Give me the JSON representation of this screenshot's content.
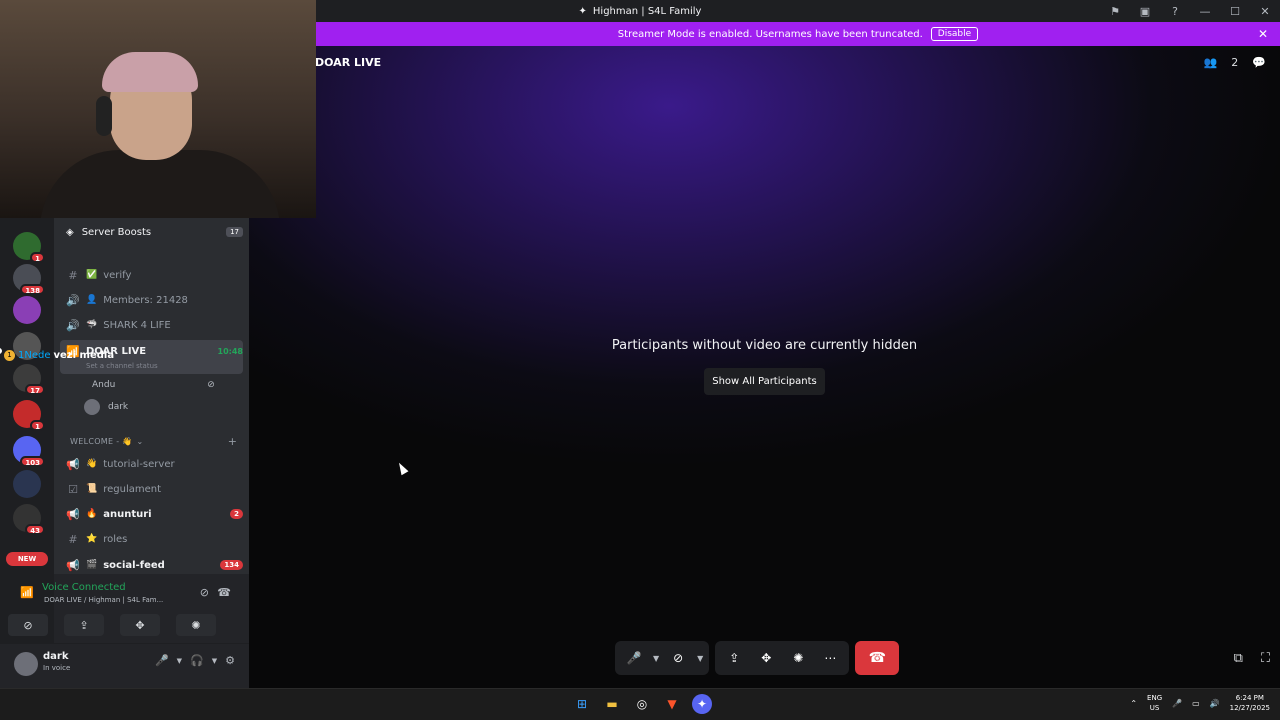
{
  "window": {
    "title": "Highman | S4L Family"
  },
  "banner": {
    "text": "Streamer Mode is enabled. Usernames have been truncated.",
    "disable_label": "Disable"
  },
  "stage": {
    "channel_name": "DOAR LIVE",
    "participant_count": "2",
    "hidden_message": "Participants without video are currently hidden",
    "show_all_label": "Show All Participants"
  },
  "servers": [
    {
      "badge": "1"
    },
    {
      "badge": "138"
    },
    {
      "badge": ""
    },
    {
      "badge": ""
    },
    {
      "badge": "17"
    },
    {
      "badge": "1"
    },
    {
      "badge": "103"
    },
    {
      "badge": ""
    },
    {
      "badge": "43"
    }
  ],
  "new_pill": "NEW",
  "overlay": {
    "count": "1",
    "name_a": "1Nede",
    "name_b": "vezi media"
  },
  "channels": {
    "boosts": {
      "label": "Server Boosts",
      "count": "17"
    },
    "items": [
      {
        "icon": "#",
        "emoji": "✅",
        "name": "verify",
        "unread": false
      },
      {
        "icon": "🔊",
        "emoji": "👤",
        "name": "Members: 21428",
        "unread": false
      },
      {
        "icon": "🔊",
        "emoji": "🦈",
        "name": "SHARK 4 LIFE",
        "unread": false
      }
    ],
    "active_voice": {
      "name": "DOAR LIVE",
      "timer": "10:48",
      "status": "Set a channel status"
    },
    "voice_users": [
      "Andu",
      "dark"
    ],
    "category": "WELCOME - 👋",
    "welcome_items": [
      {
        "icon": "📢",
        "emoji": "👋",
        "name": "tutorial-server",
        "unread": false,
        "badge": ""
      },
      {
        "icon": "☑",
        "emoji": "📜",
        "name": "regulament",
        "unread": false,
        "badge": ""
      },
      {
        "icon": "📢",
        "emoji": "🔥",
        "name": "anunturi",
        "unread": true,
        "badge": "2"
      },
      {
        "icon": "#",
        "emoji": "⭐",
        "name": "roles",
        "unread": false,
        "badge": ""
      },
      {
        "icon": "📢",
        "emoji": "🎬",
        "name": "social-feed",
        "unread": true,
        "badge": "134"
      }
    ]
  },
  "voice_panel": {
    "title": "Voice Connected",
    "subtitle": "DOAR LIVE / Highman | S4L Fam..."
  },
  "user": {
    "name": "dark",
    "status": "In voice"
  },
  "tray": {
    "lang_a": "ENG",
    "lang_b": "US",
    "time": "6:24 PM",
    "date": "12/27/2025"
  },
  "colors": {
    "accent": "#a020f0",
    "hangup": "#da373c",
    "online": "#23a55a"
  }
}
